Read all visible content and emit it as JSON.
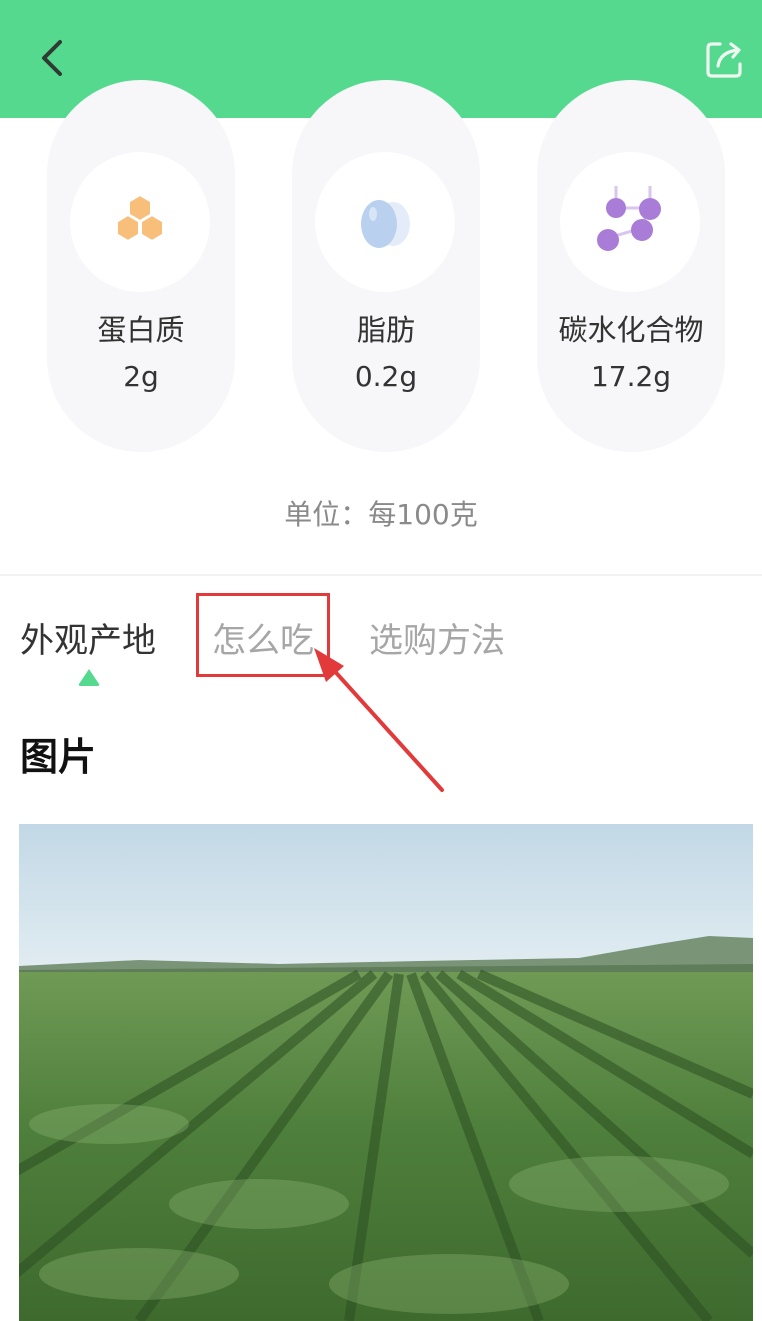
{
  "header": {
    "back_icon": "chevron-left-icon",
    "share_icon": "share-icon",
    "background_color": "#54d98f"
  },
  "nutrients": [
    {
      "name": "蛋白质",
      "value": "2g",
      "icon": "protein-hexagon-icon",
      "icon_color": "#f7bf7a"
    },
    {
      "name": "脂肪",
      "value": "0.2g",
      "icon": "egg-icon",
      "icon_color": "#b9d1ee"
    },
    {
      "name": "碳水化合物",
      "value": "17.2g",
      "icon": "molecule-icon",
      "icon_color": "#a97cd8"
    }
  ],
  "unit_note": "单位：每100克",
  "tabs": [
    {
      "label": "外观产地",
      "active": true
    },
    {
      "label": "怎么吃",
      "active": false,
      "highlighted": true
    },
    {
      "label": "选购方法",
      "active": false
    }
  ],
  "accent_color": "#54d98f",
  "annotation_color": "#e23a3a",
  "section": {
    "title": "图片",
    "image": "potato-field-photo"
  }
}
